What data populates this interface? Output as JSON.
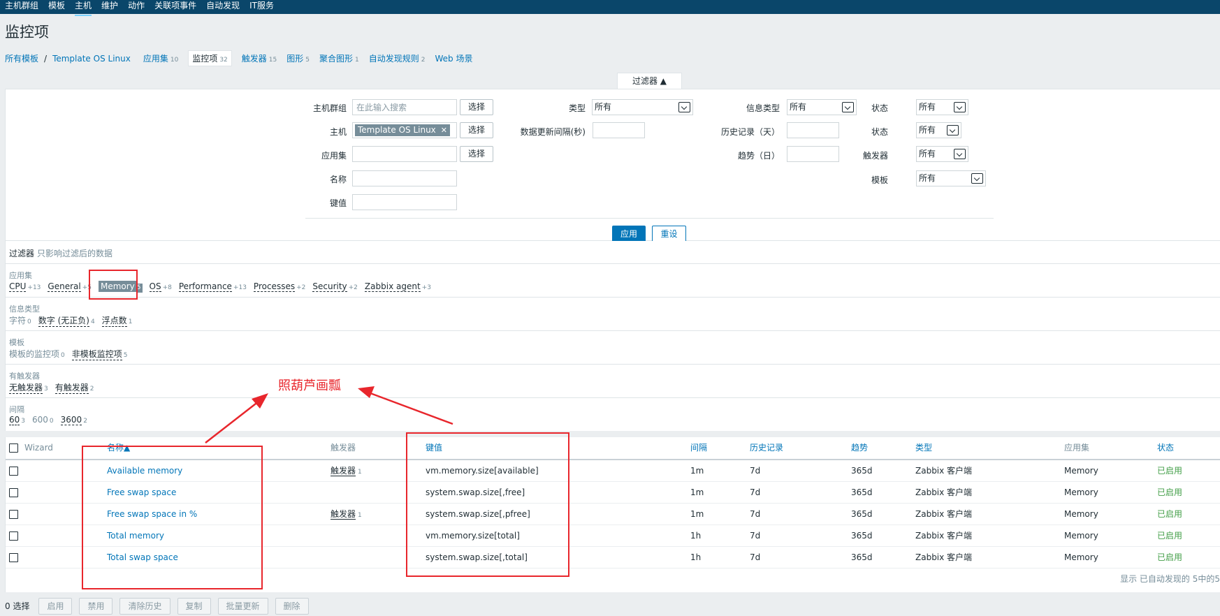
{
  "topnav": [
    "主机群组",
    "模板",
    "主机",
    "维护",
    "动作",
    "关联项事件",
    "自动发现",
    "IT服务"
  ],
  "page_title": "监控项",
  "breadcrumb": {
    "all_templates": "所有模板",
    "sep": "/",
    "template": "Template OS Linux",
    "tabs": [
      {
        "label": "应用集",
        "count": "10"
      },
      {
        "label": "监控项",
        "count": "32"
      },
      {
        "label": "触发器",
        "count": "15"
      },
      {
        "label": "图形",
        "count": "5"
      },
      {
        "label": "聚合图形",
        "count": "1"
      },
      {
        "label": "自动发现规则",
        "count": "2"
      },
      {
        "label": "Web 场景",
        "count": ""
      }
    ]
  },
  "filter": {
    "tab_label": "过滤器 ▲",
    "hostgroup_label": "主机群组",
    "hostgroup_placeholder": "在此输入搜索",
    "select_label": "选择",
    "host_label": "主机",
    "host_chip": "Template OS Linux",
    "app_label": "应用集",
    "name_label": "名称",
    "key_label": "键值",
    "type_label": "类型",
    "type_value": "所有",
    "interval_label": "数据更新间隔(秒)",
    "info_type_label": "信息类型",
    "info_type_value": "所有",
    "history_label": "历史记录（天）",
    "trends_label": "趋势（日）",
    "state_label": "状态",
    "state_value": "所有",
    "status_label": "状态",
    "status_value": "所有",
    "triggers_label": "触发器",
    "triggers_value": "所有",
    "template_label": "模板",
    "template_value": "所有",
    "apply": "应用",
    "reset": "重设"
  },
  "subfilter": {
    "title": "过滤器",
    "hint": "只影响过滤后的数据",
    "sections": [
      {
        "title": "应用集",
        "values": [
          {
            "label": "CPU",
            "count": "+13"
          },
          {
            "label": "General",
            "count": "+5"
          },
          {
            "label": "Memory",
            "count": "5"
          },
          {
            "label": "OS",
            "count": "+8"
          },
          {
            "label": "Performance",
            "count": "+13"
          },
          {
            "label": "Processes",
            "count": "+2"
          },
          {
            "label": "Security",
            "count": "+2"
          },
          {
            "label": "Zabbix agent",
            "count": "+3"
          }
        ]
      },
      {
        "title": "信息类型",
        "values": [
          {
            "label": "字符",
            "count": "0"
          },
          {
            "label": "数字 (无正负)",
            "count": "4"
          },
          {
            "label": "浮点数",
            "count": "1"
          }
        ]
      },
      {
        "title": "模板",
        "values": [
          {
            "label": "模板的监控项",
            "count": "0"
          },
          {
            "label": "非模板监控项",
            "count": "5"
          }
        ]
      },
      {
        "title": "有触发器",
        "values": [
          {
            "label": "无触发器",
            "count": "3"
          },
          {
            "label": "有触发器",
            "count": "2"
          }
        ]
      },
      {
        "title": "间隔",
        "values": [
          {
            "label": "60",
            "count": "3"
          },
          {
            "label": "600",
            "count": "0"
          },
          {
            "label": "3600",
            "count": "2"
          }
        ]
      }
    ]
  },
  "table": {
    "headers": {
      "wizard": "Wizard",
      "name": "名称▲",
      "triggers": "触发器",
      "key": "键值",
      "interval": "间隔",
      "history": "历史记录",
      "trends": "趋势",
      "type": "类型",
      "app": "应用集",
      "status": "状态"
    },
    "rows": [
      {
        "name": "Available memory",
        "trigger": "触发器",
        "trigger_count": "1",
        "key": "vm.memory.size[available]",
        "interval": "1m",
        "history": "7d",
        "trends": "365d",
        "type": "Zabbix 客户端",
        "app": "Memory",
        "status": "已启用"
      },
      {
        "name": "Free swap space",
        "trigger": "",
        "trigger_count": "",
        "key": "system.swap.size[,free]",
        "interval": "1m",
        "history": "7d",
        "trends": "365d",
        "type": "Zabbix 客户端",
        "app": "Memory",
        "status": "已启用"
      },
      {
        "name": "Free swap space in %",
        "trigger": "触发器",
        "trigger_count": "1",
        "key": "system.swap.size[,pfree]",
        "interval": "1m",
        "history": "7d",
        "trends": "365d",
        "type": "Zabbix 客户端",
        "app": "Memory",
        "status": "已启用"
      },
      {
        "name": "Total memory",
        "trigger": "",
        "trigger_count": "",
        "key": "vm.memory.size[total]",
        "interval": "1h",
        "history": "7d",
        "trends": "365d",
        "type": "Zabbix 客户端",
        "app": "Memory",
        "status": "已启用"
      },
      {
        "name": "Total swap space",
        "trigger": "",
        "trigger_count": "",
        "key": "system.swap.size[,total]",
        "interval": "1h",
        "history": "7d",
        "trends": "365d",
        "type": "Zabbix 客户端",
        "app": "Memory",
        "status": "已启用"
      }
    ],
    "display_text": "显示 已自动发现的 5中的5"
  },
  "footer": {
    "selected": "0 选择",
    "buttons": [
      "启用",
      "禁用",
      "清除历史",
      "复制",
      "批量更新",
      "删除"
    ]
  },
  "annotation": {
    "text": "照葫芦画瓢",
    "color": "#e8262c"
  },
  "colors": {
    "nav_bg": "#0a466a",
    "link": "#0275b8",
    "enabled": "#429e47",
    "primary_button": "#0275b8"
  }
}
